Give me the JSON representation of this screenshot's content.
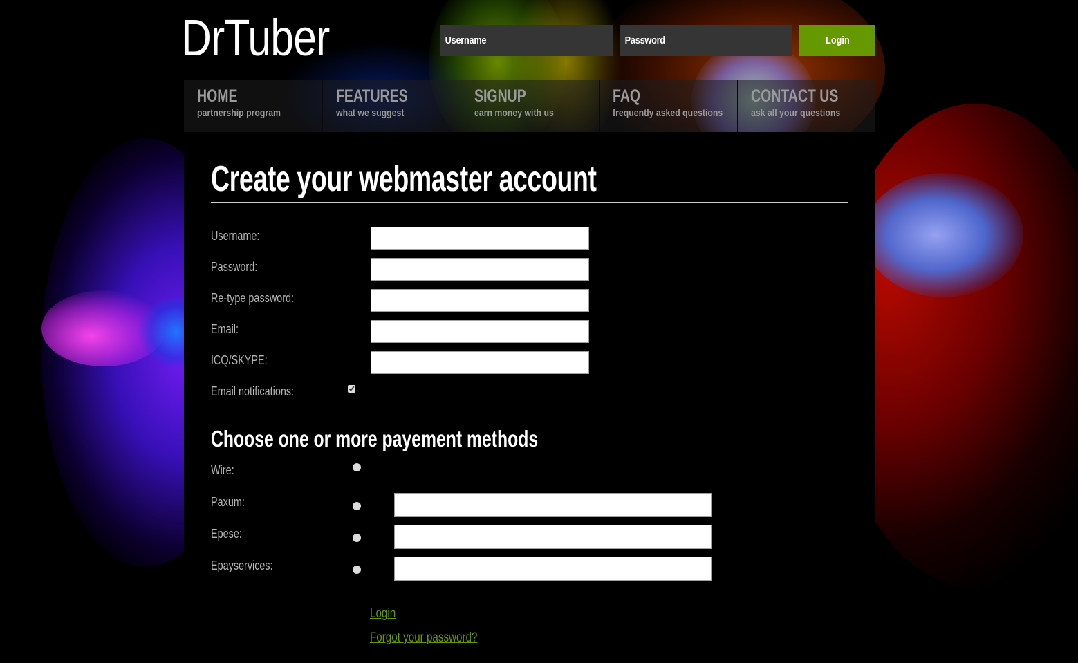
{
  "brand": {
    "logo_text": "DrTuber",
    "accent_color": "#669900"
  },
  "top_login": {
    "username_label": "Username",
    "username_value": "",
    "password_label": "Password",
    "password_value": "",
    "login_button": "Login"
  },
  "nav": {
    "items": [
      {
        "title": "HOME",
        "subtitle": "partnership program"
      },
      {
        "title": "FEATURES",
        "subtitle": "what we suggest"
      },
      {
        "title": "SIGNUP",
        "subtitle": "earn money with us"
      },
      {
        "title": "FAQ",
        "subtitle": "frequently asked questions"
      },
      {
        "title": "CONTACT US",
        "subtitle": "ask all your questions"
      }
    ]
  },
  "form": {
    "title": "Create your webmaster account",
    "fields": [
      {
        "label": "Username:",
        "value": ""
      },
      {
        "label": "Password:",
        "value": ""
      },
      {
        "label": "Re-type password:",
        "value": ""
      },
      {
        "label": "Email:",
        "value": ""
      },
      {
        "label": "ICQ/SKYPE:",
        "value": ""
      }
    ],
    "email_notifications": {
      "label": "Email notifications:",
      "checked": true
    }
  },
  "payment": {
    "title": "Choose one or more payement methods",
    "methods": [
      {
        "label": "Wire:",
        "has_field": false,
        "selected": false
      },
      {
        "label": "Paxum:",
        "has_field": true,
        "value": "",
        "selected": false
      },
      {
        "label": "Epese:",
        "has_field": true,
        "value": "",
        "selected": false
      },
      {
        "label": "Epayservices:",
        "has_field": true,
        "value": "",
        "selected": false
      }
    ]
  },
  "links": {
    "login": "Login",
    "forgot_password": "Forgot your password?"
  }
}
